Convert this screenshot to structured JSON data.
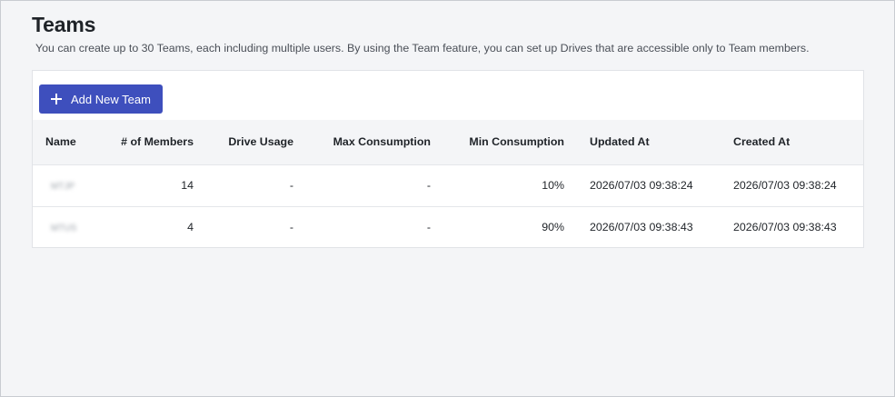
{
  "page": {
    "title": "Teams",
    "description": "You can create up to 30 Teams, each including multiple users. By using the Team feature, you can set up Drives that are accessible only to Team members."
  },
  "toolbar": {
    "add_button_label": "Add New Team",
    "add_button_icon": "plus-icon",
    "accent_color": "#3e4fbd"
  },
  "table": {
    "headers": {
      "name": "Name",
      "members": "# of Members",
      "drive_usage": "Drive Usage",
      "max_consumption": "Max Consumption",
      "min_consumption": "Min Consumption",
      "updated_at": "Updated At",
      "created_at": "Created At"
    },
    "rows": [
      {
        "name": "MTJP",
        "members": "14",
        "drive_usage": "-",
        "max_consumption": "-",
        "min_consumption": "10%",
        "updated_at": "2026/07/03 09:38:24",
        "created_at": "2026/07/03 09:38:24"
      },
      {
        "name": "MTUS",
        "members": "4",
        "drive_usage": "-",
        "max_consumption": "-",
        "min_consumption": "90%",
        "updated_at": "2026/07/03 09:38:43",
        "created_at": "2026/07/03 09:38:43"
      }
    ]
  }
}
